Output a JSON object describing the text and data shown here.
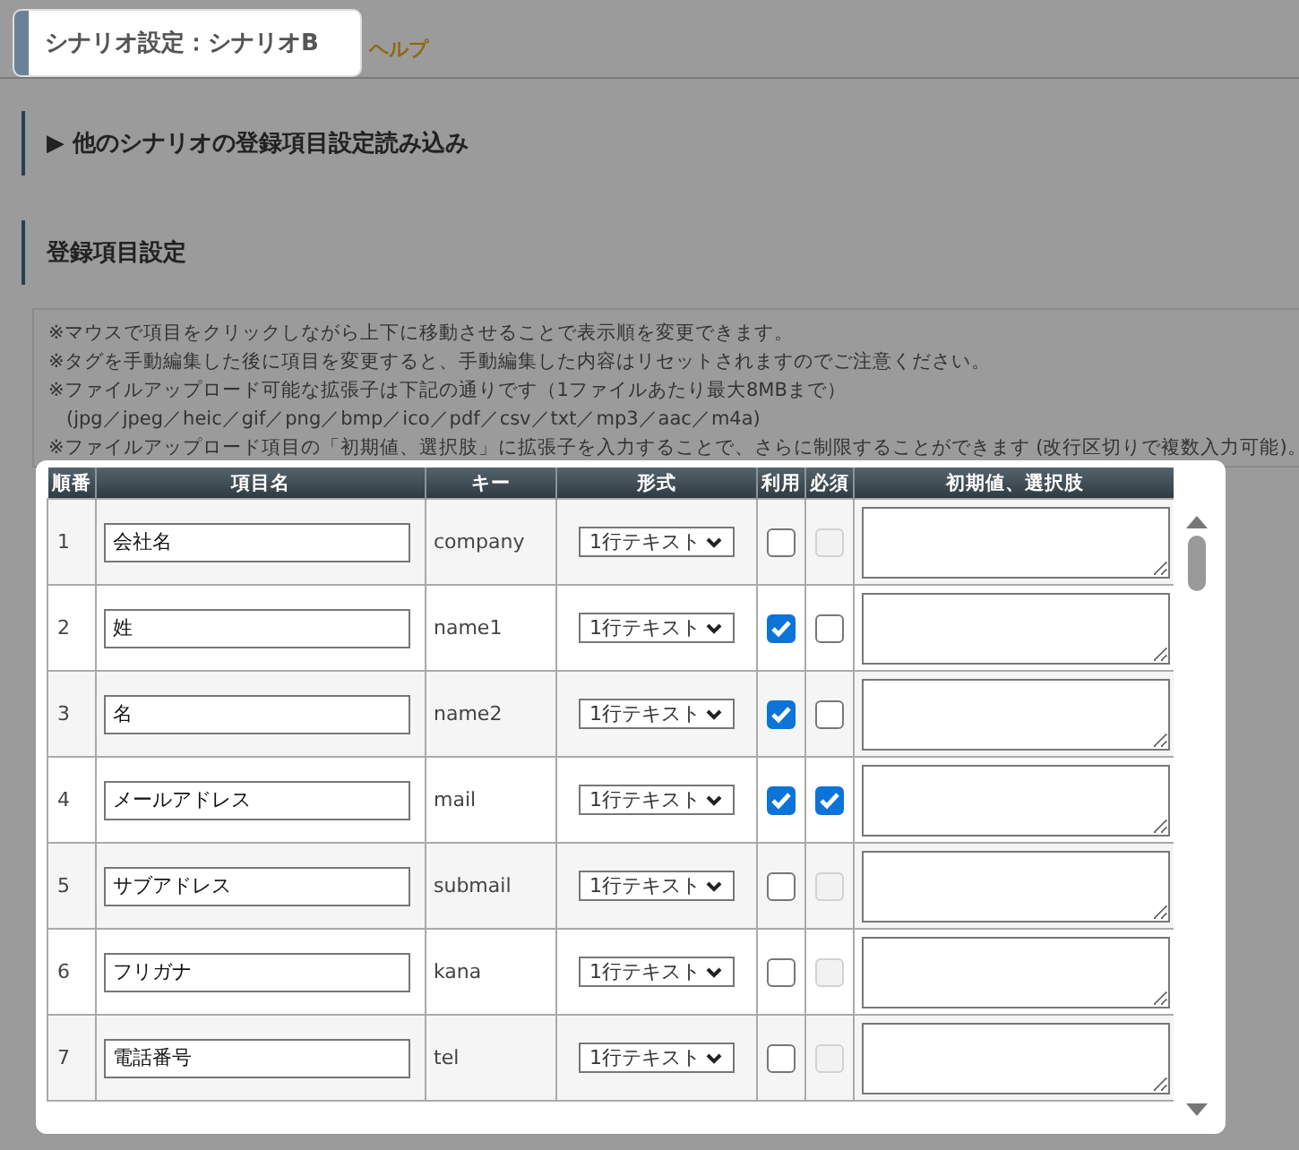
{
  "tab": {
    "title": "シナリオ設定：シナリオB"
  },
  "help_link": "ヘルプ",
  "sections": [
    {
      "label": "▶ 他のシナリオの登録項目設定読み込み"
    },
    {
      "label": "登録項目設定"
    }
  ],
  "notes": [
    {
      "kind": "main",
      "text": "※マウスで項目をクリックしながら上下に移動させることで表示順を変更できます。"
    },
    {
      "kind": "main",
      "text": "※タグを手動編集した後に項目を変更すると、手動編集した内容はリセットされますのでご注意ください。"
    },
    {
      "kind": "main",
      "text": "※ファイルアップロード可能な拡張子は下記の通りです（1ファイルあたり最大8MBまで）"
    },
    {
      "kind": "sub",
      "text": "(jpg／jpeg／heic／gif／png／bmp／ico／pdf／csv／txt／mp3／aac／m4a)"
    },
    {
      "kind": "main",
      "text": "※ファイルアップロード項目の「初期値、選択肢」に拡張子を入力することで、さらに制限することができます (改行区切りで複数入力可能)。"
    }
  ],
  "table": {
    "columns": [
      "順番",
      "項目名",
      "キー",
      "形式",
      "利用",
      "必須",
      "初期値、選択肢"
    ],
    "rows": [
      {
        "order": "1",
        "name": "会社名",
        "key": "company",
        "format": "1行テキスト",
        "use_checked": false,
        "required_checked": false,
        "required_disabled": true
      },
      {
        "order": "2",
        "name": "姓",
        "key": "name1",
        "format": "1行テキスト",
        "use_checked": true,
        "required_checked": false,
        "required_disabled": false
      },
      {
        "order": "3",
        "name": "名",
        "key": "name2",
        "format": "1行テキスト",
        "use_checked": true,
        "required_checked": false,
        "required_disabled": false
      },
      {
        "order": "4",
        "name": "メールアドレス",
        "key": "mail",
        "format": "1行テキスト",
        "use_checked": true,
        "required_checked": true,
        "required_disabled": false
      },
      {
        "order": "5",
        "name": "サブアドレス",
        "key": "submail",
        "format": "1行テキスト",
        "use_checked": false,
        "required_checked": false,
        "required_disabled": true
      },
      {
        "order": "6",
        "name": "フリガナ",
        "key": "kana",
        "format": "1行テキスト",
        "use_checked": false,
        "required_checked": false,
        "required_disabled": true
      },
      {
        "order": "7",
        "name": "電話番号",
        "key": "tel",
        "format": "1行テキスト",
        "use_checked": false,
        "required_checked": false,
        "required_disabled": true
      }
    ]
  }
}
